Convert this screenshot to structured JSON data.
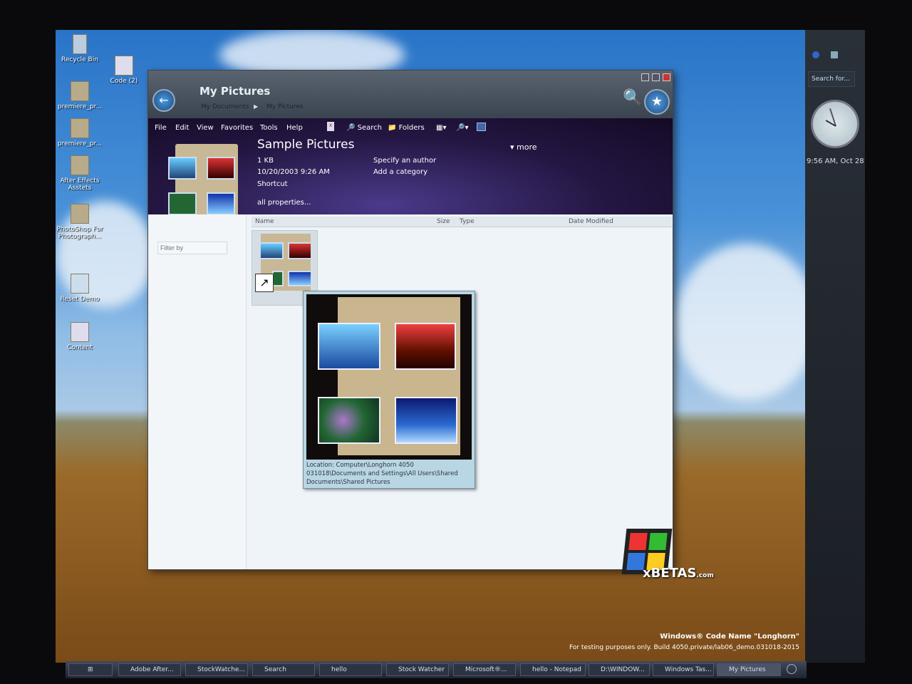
{
  "desktop_icons": [
    "Recycle Bin",
    "Code (2)",
    "premiere_pr...",
    "premiere_pr...",
    "After Effects Asstets",
    "PhotoShop For Photograph...",
    "Reset Demo",
    "Content"
  ],
  "window": {
    "title": "My Pictures",
    "breadcrumb": [
      "My Documents",
      "My Pictures"
    ],
    "menu": [
      "File",
      "Edit",
      "View",
      "Favorites",
      "Tools",
      "Help"
    ],
    "toolbar": {
      "search": "Search",
      "folders": "Folders"
    },
    "preview": {
      "name": "Sample Pictures",
      "size": "1 KB",
      "date": "10/20/2003 9:26 AM",
      "type": "Shortcut",
      "all_properties": "all properties...",
      "author": "Specify an author",
      "category": "Add a category",
      "more": "more"
    },
    "filter_placeholder": "Filter by",
    "columns": [
      "Name",
      "Size",
      "Type",
      "Date Modified"
    ],
    "tooltip": "Location: Computer\\Longhorn 4050 031018\\Documents and Settings\\All Users\\Shared Documents\\Shared Pictures"
  },
  "sidebar": {
    "search_placeholder": "Search for...",
    "clock": "9:56 AM, Oct 28"
  },
  "watermark": {
    "line1": "Windows® Code Name \"Longhorn\"",
    "line2": "For testing purposes only. Build 4050.private/lab06_demo.031018-2015",
    "logo": "xBETAS.com"
  },
  "taskbar": [
    "Adobe After...",
    "StockWatche...",
    "Search",
    "hello",
    "Stock Watcher",
    "Microsoft®...",
    "hello - Notepad",
    "D:\\WINDOW...",
    "Windows Tas...",
    "My Pictures"
  ]
}
